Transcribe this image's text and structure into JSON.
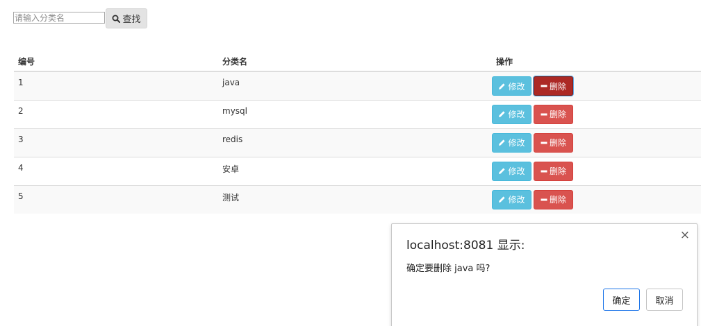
{
  "search": {
    "placeholder": "请输入分类名",
    "button_label": "查找",
    "button_icon": "search-icon"
  },
  "table": {
    "headers": [
      "编号",
      "分类名",
      "操作"
    ],
    "rows": [
      {
        "id": "1",
        "name": "java"
      },
      {
        "id": "2",
        "name": "mysql"
      },
      {
        "id": "3",
        "name": "redis"
      },
      {
        "id": "4",
        "name": "安卓"
      },
      {
        "id": "5",
        "name": "测试"
      }
    ],
    "edit_label": "修改",
    "delete_label": "删除",
    "edit_icon": "pencil-icon",
    "delete_icon": "minus-icon",
    "edit_color": "#5bc0de",
    "delete_color": "#d9534f",
    "delete_active_color": "#ac2925"
  },
  "dialog": {
    "title": "localhost:8081 显示:",
    "message": "确定要删除 java 吗?",
    "ok_label": "确定",
    "cancel_label": "取消",
    "close_symbol": "×"
  }
}
